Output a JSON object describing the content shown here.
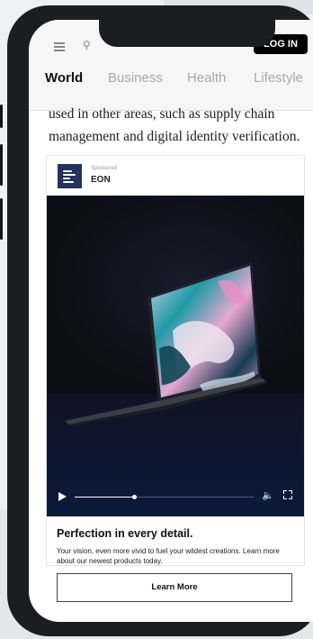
{
  "header": {
    "login_label": "LOG IN",
    "tabs": [
      {
        "label": "World",
        "active": true
      },
      {
        "label": "Business",
        "active": false
      },
      {
        "label": "Health",
        "active": false
      },
      {
        "label": "Lifestyle",
        "active": false
      }
    ]
  },
  "article": {
    "text": "used in other areas, such as supply chain management and digital identity verification."
  },
  "ad": {
    "sponsored_label": "Sponsored",
    "brand_name": "EON",
    "headline": "Perfection in every detail.",
    "description": "Your vision, even more vivid to fuel your wildest creations. Learn more about our newest products today.",
    "cta_label": "Learn More",
    "video": {
      "progress_fraction": 0.33
    }
  },
  "colors": {
    "brand_logo": "#24325e",
    "login_bg": "#000000",
    "video_bg": "#0e0f18"
  },
  "icons": [
    "menu-icon",
    "search-icon",
    "play-icon",
    "volume-icon",
    "fullscreen-icon",
    "brand-logo-icon"
  ]
}
